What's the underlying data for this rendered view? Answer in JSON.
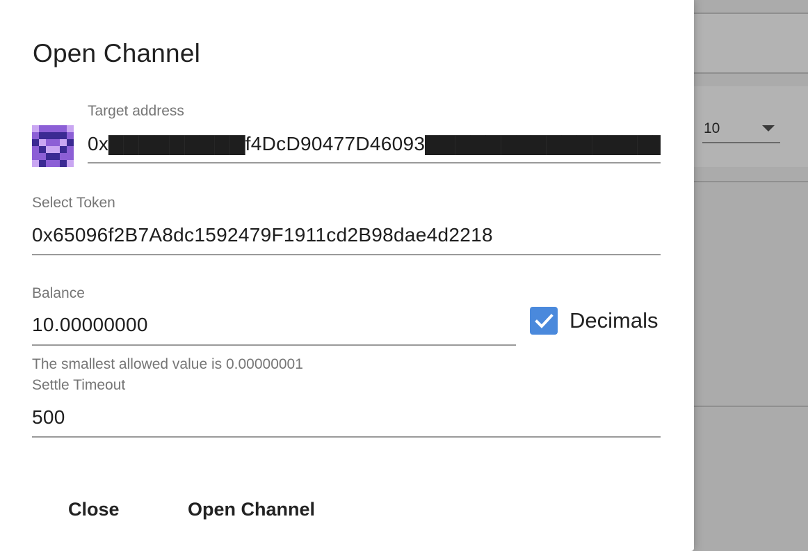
{
  "dialog": {
    "title": "Open Channel",
    "target_address": {
      "label": "Target address",
      "value": "0x▇▇▇▇▇▇▇▇▇f4DcD90477D46093▇▇▇▇▇▇▇▇▇▇▇▇▇▇▇▇▇.8"
    },
    "select_token": {
      "label": "Select Token",
      "value": "0x65096f2B7A8dc1592479F1911cd2B98dae4d2218"
    },
    "balance": {
      "label": "Balance",
      "value": "10.00000000",
      "hint": "The smallest allowed value is 0.00000001"
    },
    "decimals": {
      "label": "Decimals",
      "checked": true,
      "color": "#4a89dc"
    },
    "settle_timeout": {
      "label": "Settle Timeout",
      "value": "500"
    },
    "buttons": {
      "close": "Close",
      "open_channel": "Open Channel"
    }
  },
  "background": {
    "page_size_select": {
      "value": "10",
      "icon": "dropdown-arrow-icon"
    }
  },
  "colors": {
    "overlay": "#ababab",
    "avatar_primary": "#8c5fd6",
    "avatar_light": "#c9a6f2",
    "avatar_dark": "#3b2a93"
  }
}
